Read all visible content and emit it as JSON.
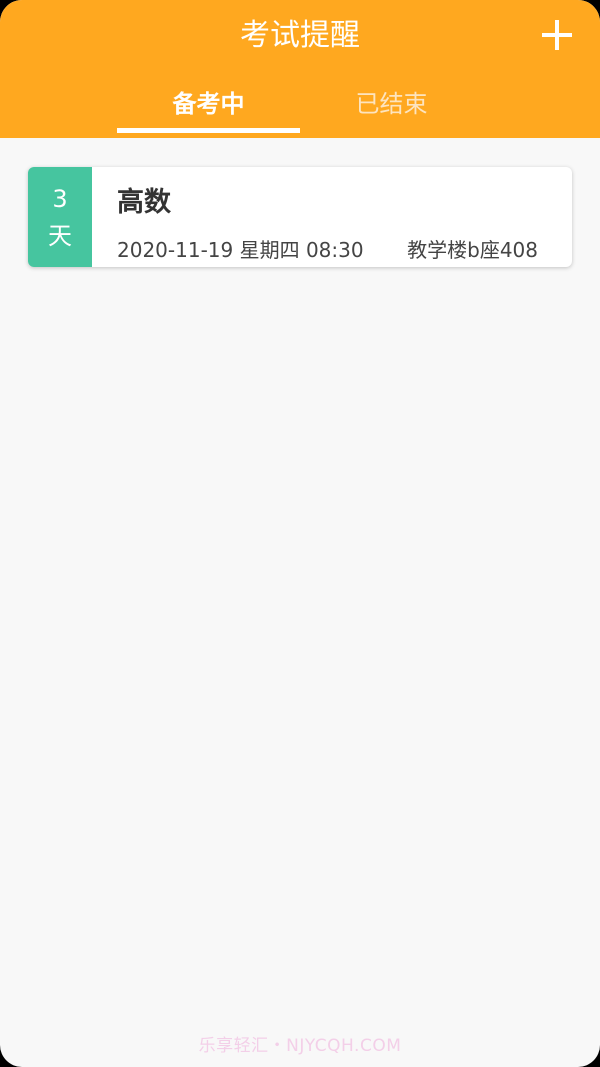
{
  "header": {
    "title": "考试提醒",
    "add_icon": "plus-icon",
    "accent_color": "#ffa81f"
  },
  "tabs": [
    {
      "label": "备考中",
      "active": true
    },
    {
      "label": "已结束",
      "active": false
    }
  ],
  "exams": [
    {
      "days_left": "3",
      "days_unit": "天",
      "name": "高数",
      "datetime": "2020-11-19 星期四 08:30",
      "location": "教学楼b座408",
      "badge_color": "#46c59f"
    }
  ],
  "watermark": "乐享轻汇・NJYCQH.COM"
}
